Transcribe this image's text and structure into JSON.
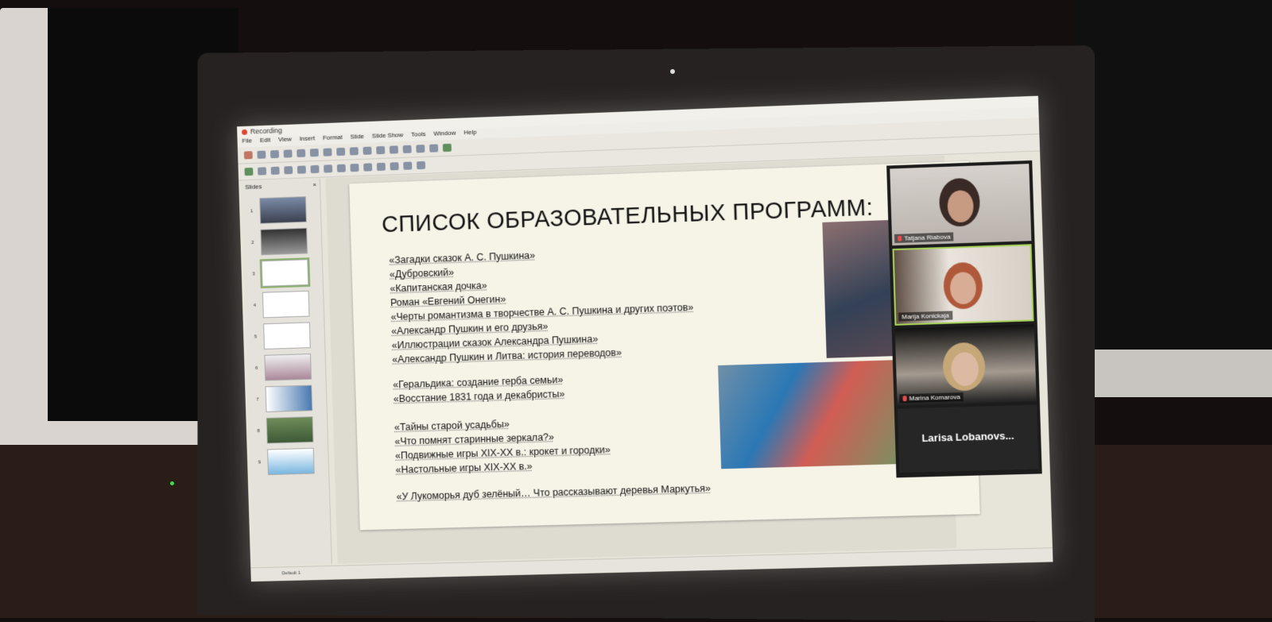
{
  "window": {
    "title": "Recording"
  },
  "menu": [
    "File",
    "Edit",
    "View",
    "Insert",
    "Format",
    "Slide",
    "Slide Show",
    "Tools",
    "Window",
    "Help"
  ],
  "slides_pane": {
    "title": "Slides",
    "close": "×",
    "numbers": [
      "1",
      "2",
      "3",
      "4",
      "5",
      "6",
      "7",
      "8",
      "9"
    ],
    "active": 3
  },
  "slide": {
    "title": "СПИСОК ОБРАЗОВАТЕЛЬНЫХ ПРОГРАММ:",
    "programs": [
      "«Загадки сказок А. С. Пушкина»",
      "«Дубровский»",
      "«Капитанская дочка»",
      "Роман «Евгений Онегин»",
      "«Черты романтизма в творчестве А. С. Пушкина и других поэтов»",
      "«Александр Пушкин и его друзья»",
      "«Иллюстрации сказок Александра Пушкина»",
      "«Александр Пушкин и Литва: история переводов»",
      "«Геральдика: создание герба семьи»",
      "«Восстание 1831 года и декабристы»",
      "«Тайны старой усадьбы»",
      "«Что помнят старинные зеркала?»",
      "«Подвижные игры XIX-XX в.: крокет и городки»",
      "«Настольные игры XIX-XX в.»",
      "«У Лукоморья дуб зелёный… Что рассказывают деревья Маркутья»"
    ]
  },
  "statusbar": {
    "layout": "Default 1"
  },
  "participants": [
    {
      "name": "Tatjana Riabova"
    },
    {
      "name": "Marija Konickaja"
    },
    {
      "name": "Marina Komarova"
    },
    {
      "name": "Larisa  Lobanovs..."
    }
  ],
  "colors": {
    "screen": "#e7e4da",
    "slide": "#f6f3e7",
    "active_border": "#a8d35a",
    "mic_muted": "#e64c4c"
  }
}
